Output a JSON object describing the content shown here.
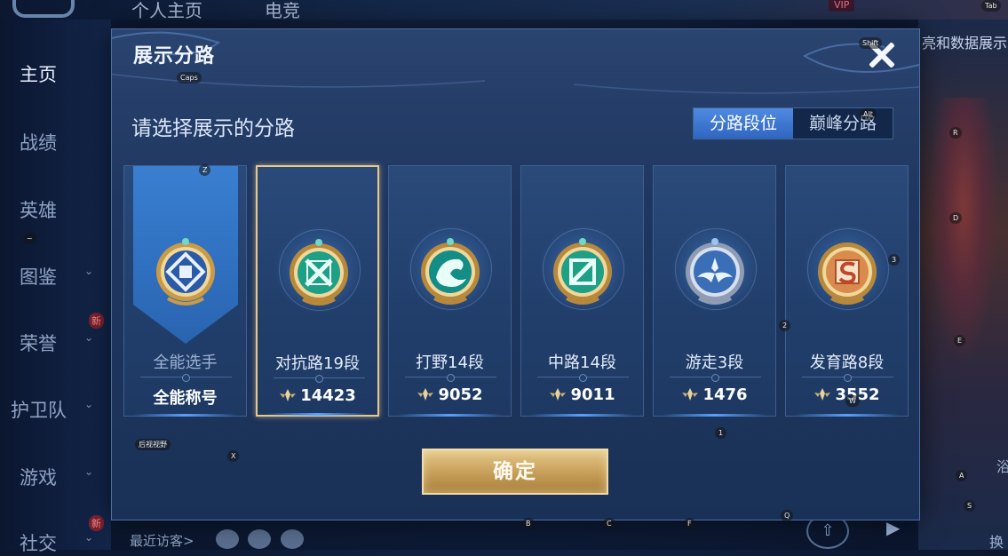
{
  "background": {
    "top_items": [
      "个人主页",
      "电竞"
    ],
    "vip_badge": "VIP",
    "tab_hint": "Tab",
    "right_header": "亮和数据展示",
    "sidebar": [
      {
        "label": "主页",
        "active": true
      },
      {
        "label": "战绩"
      },
      {
        "label": "英雄"
      },
      {
        "label": "图鉴",
        "chevron": "⌄"
      },
      {
        "label": "荣誉",
        "chevron": "⌄",
        "badge": "新"
      },
      {
        "label": "护卫队",
        "chevron": "⌄"
      },
      {
        "label": "游戏",
        "chevron": "⌄"
      },
      {
        "label": "社交",
        "chevron": "⌄",
        "badge": "新"
      }
    ],
    "bottom_text": "最近访客>",
    "right_caption_1": "浴",
    "right_caption_2": "换"
  },
  "modal": {
    "title": "展示分路",
    "subtitle": "请选择展示的分路",
    "toggle": [
      {
        "label": "分路段位",
        "active": true
      },
      {
        "label": "巅峰分路",
        "active": false
      }
    ],
    "cards": [
      {
        "name": "全能选手",
        "stat": "全能称号",
        "emblem": "all-round-emblem-icon",
        "show_points": false,
        "selected": false
      },
      {
        "name": "对抗路19段",
        "stat": "14423",
        "emblem": "clash-lane-emblem-icon",
        "show_points": true,
        "selected": true
      },
      {
        "name": "打野14段",
        "stat": "9052",
        "emblem": "jungle-dragon-emblem-icon",
        "show_points": true,
        "selected": false
      },
      {
        "name": "中路14段",
        "stat": "9011",
        "emblem": "mid-lane-emblem-icon",
        "show_points": true,
        "selected": false
      },
      {
        "name": "游走3段",
        "stat": "1476",
        "emblem": "roam-wings-emblem-icon",
        "show_points": true,
        "selected": false
      },
      {
        "name": "发育路8段",
        "stat": "3552",
        "emblem": "farm-lane-emblem-icon",
        "show_points": true,
        "selected": false
      }
    ],
    "confirm_label": "确定"
  },
  "keybind_hints": {
    "caps": "Caps",
    "shift": "Shift",
    "alt": "Alt",
    "tab": "Tab",
    "z": "Z",
    "x": "X",
    "r": "R",
    "d": "D",
    "e": "E",
    "num3": "3",
    "num2": "2",
    "num1": "1",
    "w": "W",
    "a": "A",
    "s": "S",
    "b": "B",
    "c": "C",
    "f": "F",
    "q": "Q",
    "tilde": "~",
    "shortcut": "后视视野"
  },
  "colors": {
    "selected_border": "#e9c98b",
    "toggle_active": "#3f7ad6",
    "confirm_gold": "#c9a15b"
  }
}
